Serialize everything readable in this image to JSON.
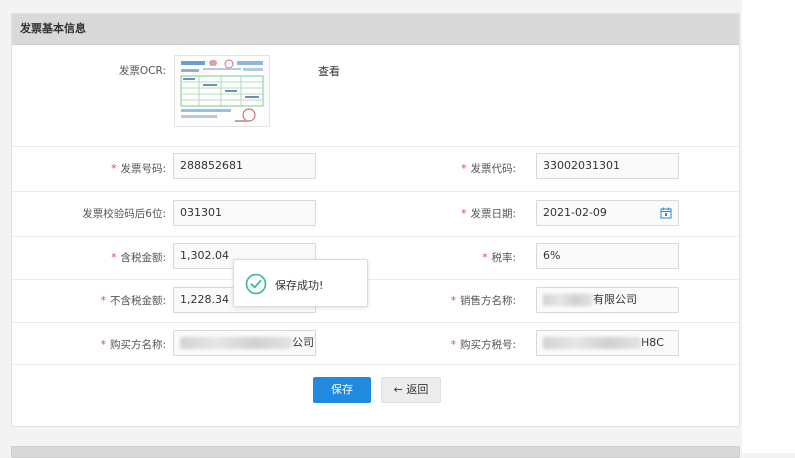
{
  "panel": {
    "title": "发票基本信息"
  },
  "ocr": {
    "label": "发票OCR:",
    "view_link": "查看"
  },
  "fields": {
    "invoice_number": {
      "label": "发票号码:",
      "value": "288852681"
    },
    "invoice_code": {
      "label": "发票代码:",
      "value": "33002031301"
    },
    "check_code": {
      "label": "发票校验码后6位:",
      "value": "031301"
    },
    "invoice_date": {
      "label": "发票日期:",
      "value": "2021-02-09"
    },
    "amount_with_tax": {
      "label": "含税金额:",
      "value": "1,302.04"
    },
    "tax_rate": {
      "label": "税率:",
      "value": "6%"
    },
    "amount_without_tax": {
      "label": "不含税金额:",
      "value": "1,228.34"
    },
    "seller_name": {
      "label": "销售方名称:",
      "value_visible": "有限公司"
    },
    "buyer_name": {
      "label": "购买方名称:",
      "value_visible": "公司"
    },
    "buyer_tax_id": {
      "label": "购买方税号:",
      "value_visible": "H8C"
    }
  },
  "required_mark": "*",
  "buttons": {
    "save": "保存",
    "back": "返回",
    "back_arrow": "←"
  },
  "toast": {
    "message": "保存成功!"
  },
  "icons": {
    "calendar": "calendar-icon",
    "success": "check-circle-icon"
  },
  "colors": {
    "primary": "#1f8ae0",
    "required": "#e8473b",
    "success": "#2dbd8f",
    "header_bg": "#d9d9d9"
  }
}
